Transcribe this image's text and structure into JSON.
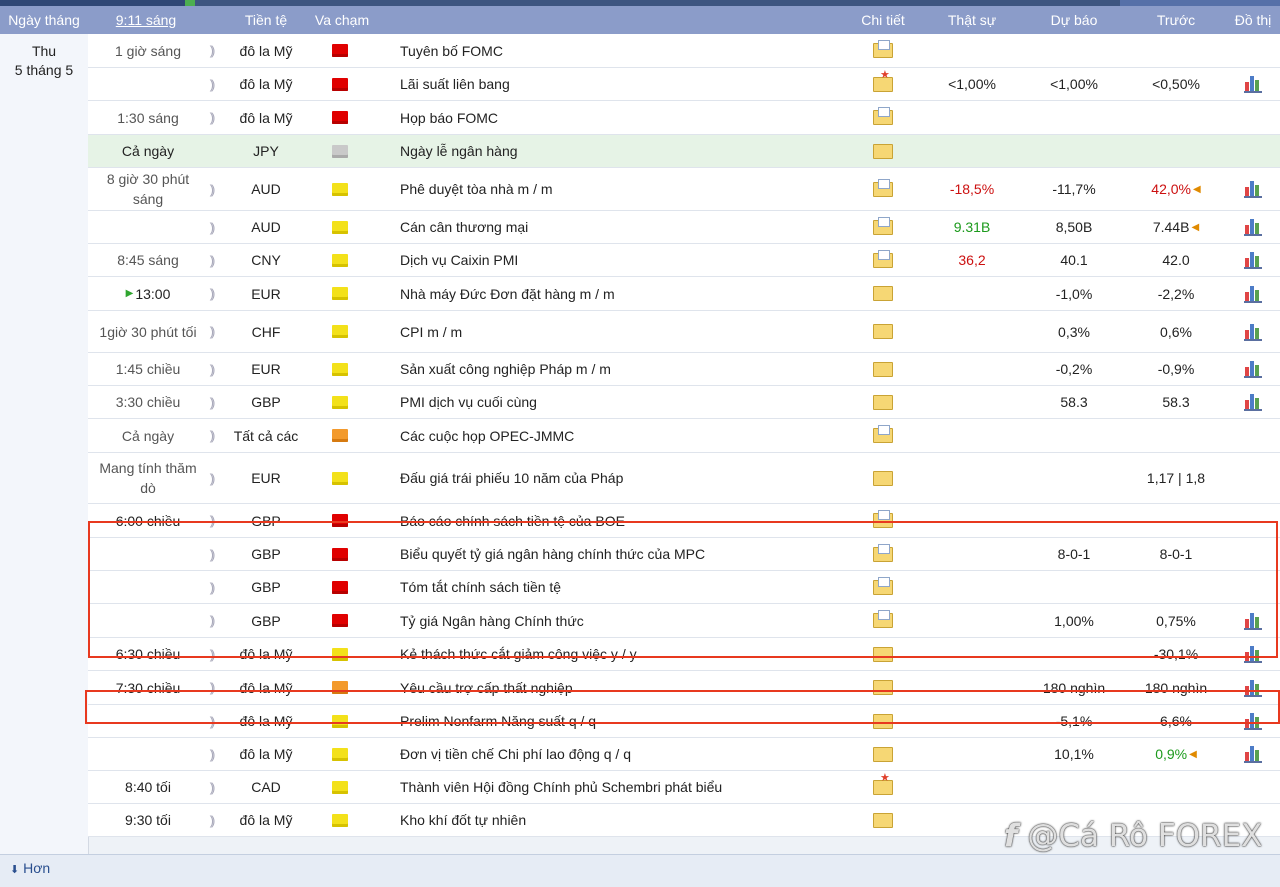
{
  "header": {
    "date": "Ngày tháng",
    "time": "9:11 sáng",
    "currency": "Tiền tệ",
    "impact": "Va chạm",
    "detail": "Chi tiết",
    "actual": "Thật sự",
    "forecast": "Dự báo",
    "previous": "Trước",
    "graph": "Đồ thị"
  },
  "day": {
    "weekday": "Thu",
    "date": "5 tháng 5"
  },
  "events": [
    {
      "time": "1 giờ sáng",
      "currency": "đô la Mỹ",
      "impact": "red",
      "event": "Tuyên bố FOMC",
      "detail": "doc",
      "actual": "",
      "forecast": "",
      "previous": "",
      "chart": false
    },
    {
      "time": "",
      "currency": "đô la Mỹ",
      "impact": "red",
      "event": "Lãi suất liên bang",
      "detail": "star",
      "actual": "<1,00%",
      "forecast": "<1,00%",
      "previous": "<0,50%",
      "chart": true
    },
    {
      "time": "1:30 sáng",
      "currency": "đô la Mỹ",
      "impact": "red",
      "event": "Họp báo FOMC",
      "detail": "doc",
      "actual": "",
      "forecast": "",
      "previous": "",
      "chart": false
    },
    {
      "time": "Cả ngày",
      "currency": "JPY",
      "impact": "gray",
      "event": "Ngày lễ ngân hàng",
      "detail": "plain",
      "actual": "",
      "forecast": "",
      "previous": "",
      "chart": false,
      "holiday": true
    },
    {
      "time": "8 giờ 30 phút sáng",
      "currency": "AUD",
      "impact": "yellow",
      "event": "Phê duyệt tòa nhà m / m",
      "detail": "doc",
      "actual": "-18,5%",
      "actual_color": "red",
      "forecast": "-11,7%",
      "previous": "42,0%",
      "previous_color": "red",
      "previous_revised": true,
      "chart": true
    },
    {
      "time": "",
      "currency": "AUD",
      "impact": "yellow",
      "event": "Cán cân thương mại",
      "detail": "doc",
      "actual": "9.31B",
      "actual_color": "green",
      "forecast": "8,50B",
      "previous": "7.44B",
      "previous_revised": true,
      "chart": true
    },
    {
      "time": "8:45 sáng",
      "currency": "CNY",
      "impact": "yellow",
      "event": "Dịch vụ Caixin PMI",
      "detail": "doc",
      "actual": "36,2",
      "actual_color": "red",
      "forecast": "40.1",
      "previous": "42.0",
      "chart": true
    },
    {
      "time": "13:00",
      "time_upcoming": true,
      "currency": "EUR",
      "impact": "yellow",
      "event": "Nhà máy Đức Đơn đặt hàng m / m",
      "detail": "plain",
      "actual": "",
      "forecast": "-1,0%",
      "previous": "-2,2%",
      "chart": true
    },
    {
      "time": "1giờ 30 phút tối",
      "currency": "CHF",
      "impact": "yellow",
      "event": "CPI m / m",
      "detail": "plain",
      "actual": "",
      "forecast": "0,3%",
      "previous": "0,6%",
      "chart": true
    },
    {
      "time": "1:45 chiều",
      "currency": "EUR",
      "impact": "yellow",
      "event": "Sản xuất công nghiệp Pháp m / m",
      "detail": "plain",
      "actual": "",
      "forecast": "-0,2%",
      "previous": "-0,9%",
      "chart": true
    },
    {
      "time": "3:30 chiều",
      "currency": "GBP",
      "impact": "yellow",
      "event": "PMI dịch vụ cuối cùng",
      "detail": "plain",
      "actual": "",
      "forecast": "58.3",
      "previous": "58.3",
      "chart": true
    },
    {
      "time": "Cả ngày",
      "currency": "Tất cả các",
      "impact": "orange",
      "event": "Các cuộc họp OPEC-JMMC",
      "detail": "doc",
      "actual": "",
      "forecast": "",
      "previous": "",
      "chart": false
    },
    {
      "time": "Mang tính thăm dò",
      "currency": "EUR",
      "impact": "yellow",
      "event": "Đấu giá trái phiếu 10 năm của Pháp",
      "detail": "plain",
      "actual": "",
      "forecast": "",
      "previous": "1,17 | 1,8",
      "chart": false
    },
    {
      "time": "6:00 chiều",
      "time_dark": true,
      "currency": "GBP",
      "impact": "red",
      "event": "Báo cáo chính sách tiền tệ của BOE",
      "detail": "doc",
      "actual": "",
      "forecast": "",
      "previous": "",
      "chart": false
    },
    {
      "time": "",
      "currency": "GBP",
      "impact": "red",
      "event": "Biểu quyết tỷ giá ngân hàng chính thức của MPC",
      "detail": "doc",
      "actual": "",
      "forecast": "8-0-1",
      "previous": "8-0-1",
      "chart": false
    },
    {
      "time": "",
      "currency": "GBP",
      "impact": "red",
      "event": "Tóm tắt chính sách tiền tệ",
      "detail": "doc",
      "actual": "",
      "forecast": "",
      "previous": "",
      "chart": false
    },
    {
      "time": "",
      "currency": "GBP",
      "impact": "red",
      "event": "Tỷ giá Ngân hàng Chính thức",
      "detail": "doc",
      "actual": "",
      "forecast": "1,00%",
      "previous": "0,75%",
      "chart": true
    },
    {
      "time": "6:30 chiều",
      "time_dark": true,
      "currency": "đô la Mỹ",
      "impact": "yellow",
      "event": "Kẻ thách thức cắt giảm công việc y / y",
      "detail": "plain",
      "actual": "",
      "forecast": "",
      "previous": "-30,1%",
      "chart": true
    },
    {
      "time": "7:30 chiều",
      "time_dark": true,
      "currency": "đô la Mỹ",
      "impact": "orange",
      "event": "Yêu cầu trợ cấp thất nghiệp",
      "detail": "plain",
      "actual": "",
      "forecast": "180 nghìn",
      "previous": "180 nghìn",
      "chart": true
    },
    {
      "time": "",
      "currency": "đô la Mỹ",
      "impact": "yellow",
      "event": "Prelim Nonfarm Năng suất q / q",
      "detail": "plain",
      "actual": "",
      "forecast": "-5,1%",
      "previous": "6,6%",
      "chart": true
    },
    {
      "time": "",
      "currency": "đô la Mỹ",
      "impact": "yellow",
      "event": "Đơn vị tiền chế Chi phí lao động q / q",
      "detail": "plain",
      "actual": "",
      "forecast": "10,1%",
      "previous": "0,9%",
      "previous_color": "green",
      "previous_revised": true,
      "chart": true
    },
    {
      "time": "8:40 tối",
      "time_dark": true,
      "currency": "CAD",
      "impact": "yellow",
      "event": "Thành viên Hội đồng Chính phủ Schembri phát biểu",
      "detail": "star",
      "actual": "",
      "forecast": "",
      "previous": "",
      "chart": false
    },
    {
      "time": "9:30 tối",
      "time_dark": true,
      "currency": "đô la Mỹ",
      "impact": "yellow",
      "event": "Kho khí đốt tự nhiên",
      "detail": "plain",
      "actual": "",
      "forecast": "",
      "previous": "",
      "chart": false
    }
  ],
  "footer": {
    "more_label": "Hơn"
  },
  "watermark": "@Cá Rô FOREX"
}
